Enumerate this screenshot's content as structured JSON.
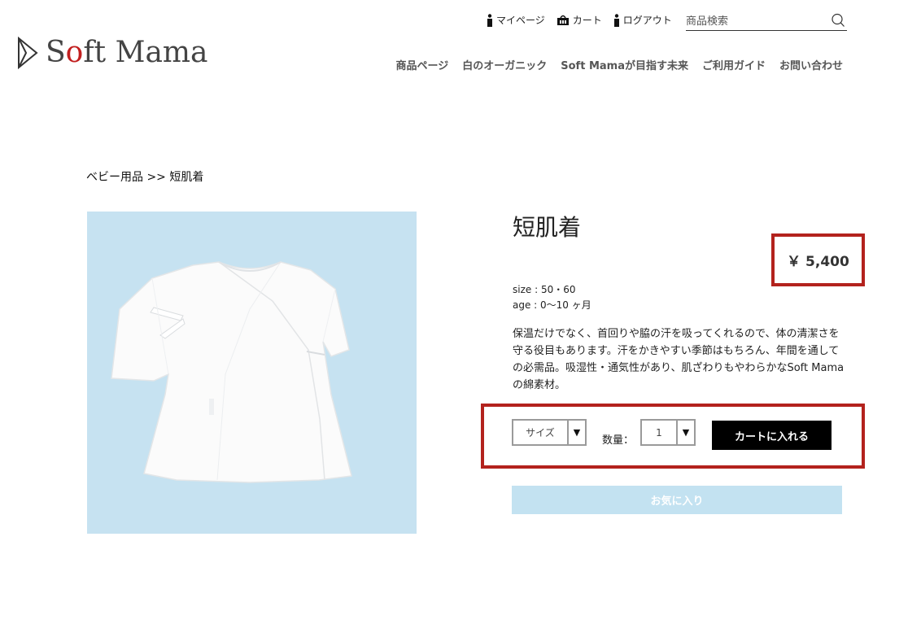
{
  "header": {
    "logo": {
      "text_before": "S",
      "text_o": "o",
      "text_after": "ft Mama"
    },
    "utility": {
      "mypage": "マイページ",
      "cart": "カート",
      "logout": "ログアウト"
    },
    "search": {
      "placeholder": "商品検索"
    },
    "nav": [
      {
        "label": "商品ページ"
      },
      {
        "label": "白のオーガニック"
      },
      {
        "label": "Soft Mamaが目指す未来"
      },
      {
        "label": "ご利用ガイド"
      },
      {
        "label": "お問い合わせ"
      }
    ]
  },
  "breadcrumb": "ベビー用品 >> 短肌着",
  "product": {
    "title": "短肌着",
    "price": "￥ 5,400",
    "size": "size : 50・60",
    "age": "age : 0〜10 ヶ月",
    "description": "保温だけでなく、首回りや脇の汗を吸ってくれるので、体の清潔さを守る役目もあります。汗をかきやすい季節はもちろん、年間を通しての必需品。吸湿性・通気性があり、肌ざわりもやわらかなSoft Mamaの綿素材。",
    "size_select": "サイズ",
    "qty_label": "数量：",
    "qty_value": "1",
    "cart_button": "カートに入れる",
    "favorite_button": "お気に入り"
  },
  "colors": {
    "highlight": "#b3221d",
    "image_bg": "#c6e2f1",
    "favorite_bg": "#c3e2f1",
    "logo_accent": "#c21f1f"
  }
}
